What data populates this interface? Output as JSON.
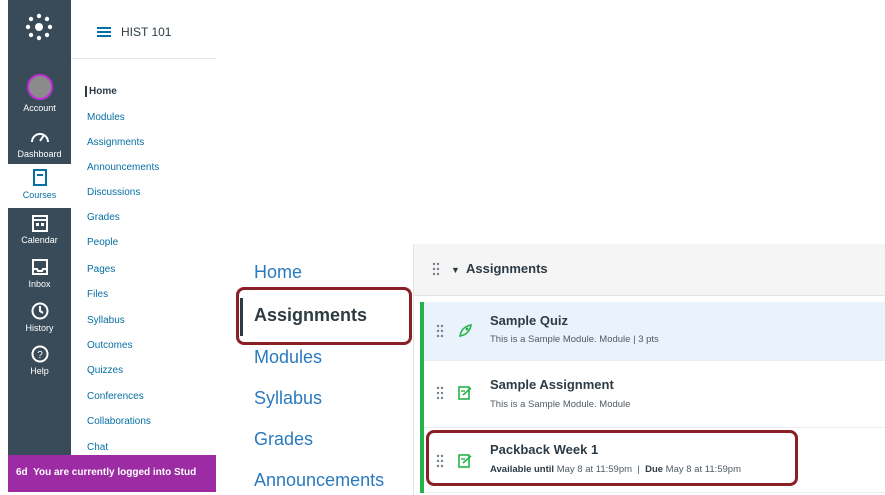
{
  "global_nav": {
    "items": [
      {
        "label": "Account",
        "icon": "account-avatar"
      },
      {
        "label": "Dashboard",
        "icon": "dashboard-icon"
      },
      {
        "label": "Courses",
        "icon": "courses-icon"
      },
      {
        "label": "Calendar",
        "icon": "calendar-icon"
      },
      {
        "label": "Inbox",
        "icon": "inbox-icon"
      },
      {
        "label": "History",
        "icon": "history-icon"
      },
      {
        "label": "Help",
        "icon": "help-icon"
      }
    ]
  },
  "course_header": {
    "title": "HIST 101"
  },
  "course_menu": {
    "items": [
      "Home",
      "Modules",
      "Assignments",
      "Announcements",
      "Discussions",
      "Grades",
      "People",
      "Pages",
      "Files",
      "Syllabus",
      "Outcomes",
      "Quizzes",
      "Conferences",
      "Collaborations",
      "Chat"
    ]
  },
  "banner": {
    "icon": "6d",
    "text": "You are currently logged into Stud"
  },
  "zoom_menu": {
    "items": [
      "Home",
      "Assignments",
      "Modules",
      "Syllabus",
      "Grades",
      "Announcements"
    ]
  },
  "module": {
    "title": "Assignments",
    "items": [
      {
        "title": "Sample Quiz",
        "subtitle": "This is a Sample Module. Module  |  3 pts"
      },
      {
        "title": "Sample Assignment",
        "subtitle": "This is a Sample Module. Module"
      },
      {
        "title": "Packback Week 1",
        "avail_label": "Available until",
        "avail_value": "May 8 at 11:59pm",
        "sep": "|",
        "due_label": "Due",
        "due_value": "May 8 at 11:59pm"
      }
    ]
  },
  "colors": {
    "nav_bg": "#394B58",
    "link": "#0770a3",
    "highlight_box": "#8a1f26",
    "published_green": "#26b34b",
    "banner": "#9c2ba4"
  }
}
